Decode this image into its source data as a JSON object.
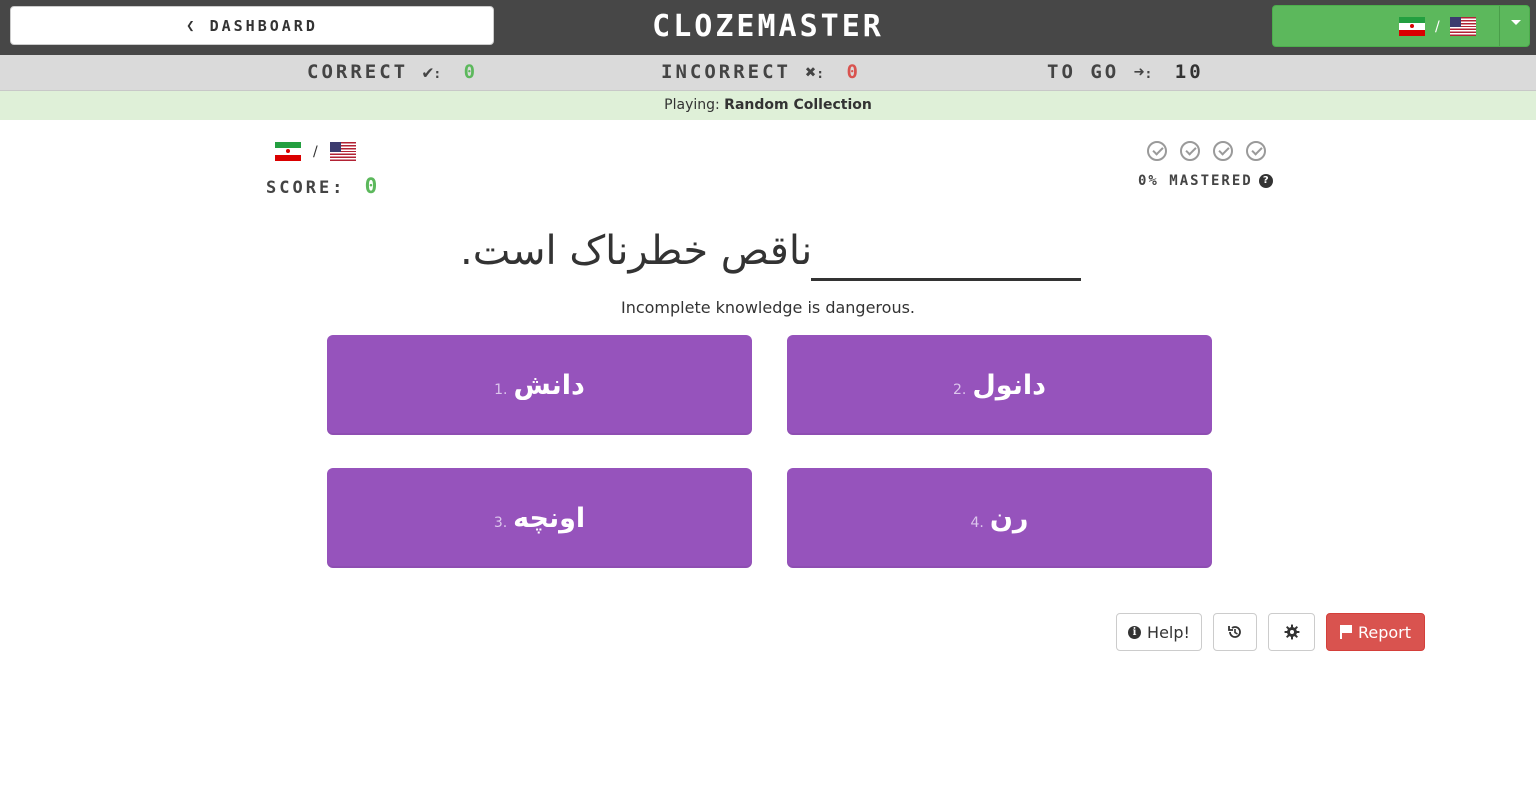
{
  "header": {
    "dashboard_label": "DASHBOARD",
    "logo": "CLOZEMASTER",
    "lang_separator": "/"
  },
  "stats": {
    "correct_label": "CORRECT",
    "correct_value": "0",
    "incorrect_label": "INCORRECT",
    "incorrect_value": "0",
    "togo_label": "TO GO",
    "togo_value": "10",
    "colon": ":"
  },
  "playing": {
    "prefix": "Playing:",
    "collection": "Random Collection"
  },
  "score": {
    "label": "SCORE:",
    "value": "0",
    "pair_separator": "/"
  },
  "mastery": {
    "label": "0% MASTERED",
    "help_glyph": "?"
  },
  "sentence": {
    "text": "ناقص خطرناک است.",
    "translation": "Incomplete knowledge is dangerous."
  },
  "options": [
    {
      "number": "1.",
      "word": "دانش"
    },
    {
      "number": "2.",
      "word": "دانول"
    },
    {
      "number": "3.",
      "word": "اونچه"
    },
    {
      "number": "4.",
      "word": "رن"
    }
  ],
  "actions": {
    "help_label": "Help!",
    "report_label": "Report"
  },
  "colors": {
    "option_bg": "#9653bc",
    "correct": "#5cb85c",
    "incorrect": "#d9534f",
    "report_bg": "#d9534f",
    "playing_bg": "#dff0d8"
  }
}
